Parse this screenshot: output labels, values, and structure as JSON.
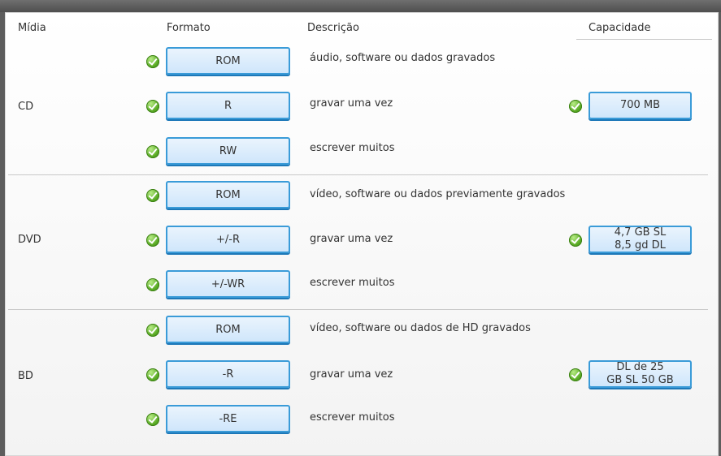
{
  "headers": {
    "midia": "Mídia",
    "formato": "Formato",
    "descricao": "Descrição",
    "capacidade": "Capacidade"
  },
  "rows": [
    {
      "media": "CD",
      "formats": [
        {
          "format": "ROM",
          "description": "áudio, software ou dados gravados"
        },
        {
          "format": "R",
          "description": "gravar uma vez"
        },
        {
          "format": "RW",
          "description": "escrever muitos"
        }
      ],
      "capacity_lines": [
        "700 MB"
      ]
    },
    {
      "media": "DVD",
      "formats": [
        {
          "format": "ROM",
          "description": "vídeo, software ou dados previamente gravados"
        },
        {
          "format": "+/-R",
          "description": "gravar uma vez"
        },
        {
          "format": "+/-WR",
          "description": "escrever muitos"
        }
      ],
      "capacity_lines": [
        "4,7 GB SL",
        "8,5 gd DL"
      ]
    },
    {
      "media": "BD",
      "formats": [
        {
          "format": "ROM",
          "description": "vídeo, software ou dados de HD gravados"
        },
        {
          "format": "-R",
          "description": "gravar uma vez"
        },
        {
          "format": "-RE",
          "description": "escrever muitos"
        }
      ],
      "capacity_lines": [
        "DL de 25",
        "GB SL 50 GB"
      ]
    }
  ],
  "colors": {
    "check": "#5aab25",
    "button_border": "#3a9bd8",
    "button_fill": "#dceefc"
  },
  "icons": {
    "check": "check-circle-icon"
  }
}
